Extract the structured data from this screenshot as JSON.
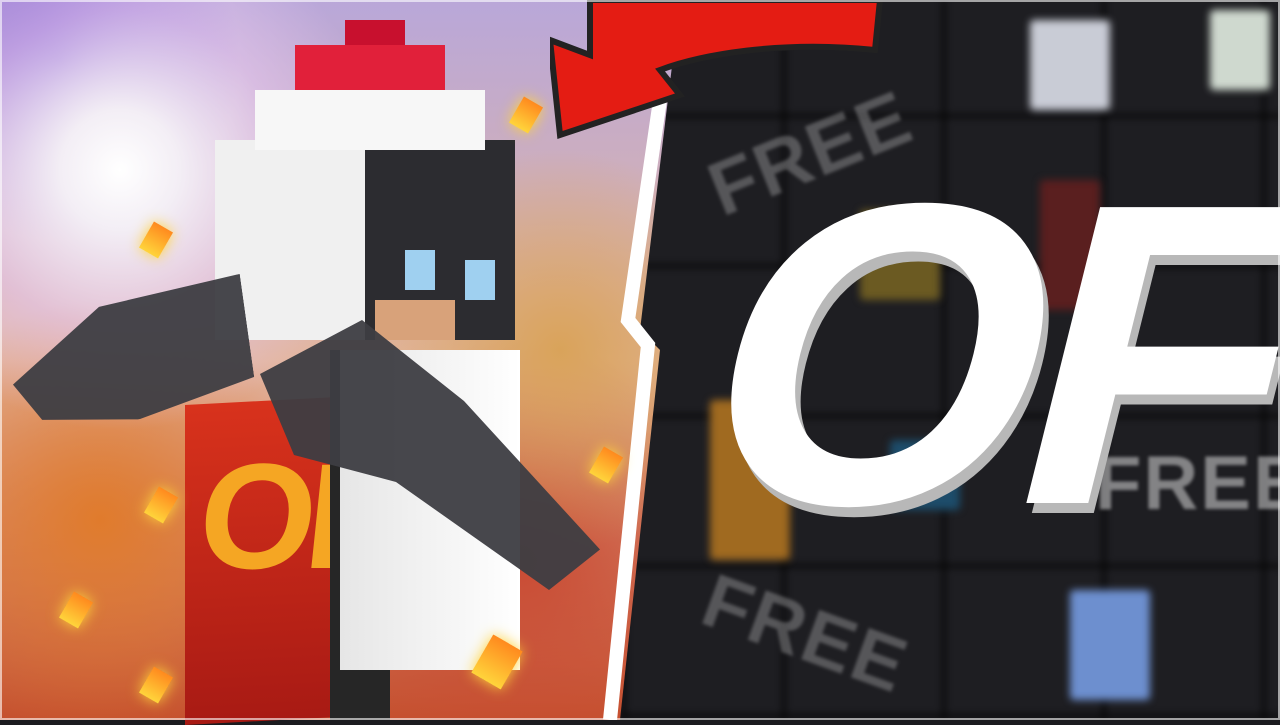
{
  "logo_text": "OF",
  "cape_text": "OF",
  "free_labels": [
    "FREE",
    "FREE",
    "FREE"
  ],
  "colors": {
    "accent_red": "#e41c13",
    "cape_gold": "#f5a623",
    "logo_white": "#ffffff"
  }
}
